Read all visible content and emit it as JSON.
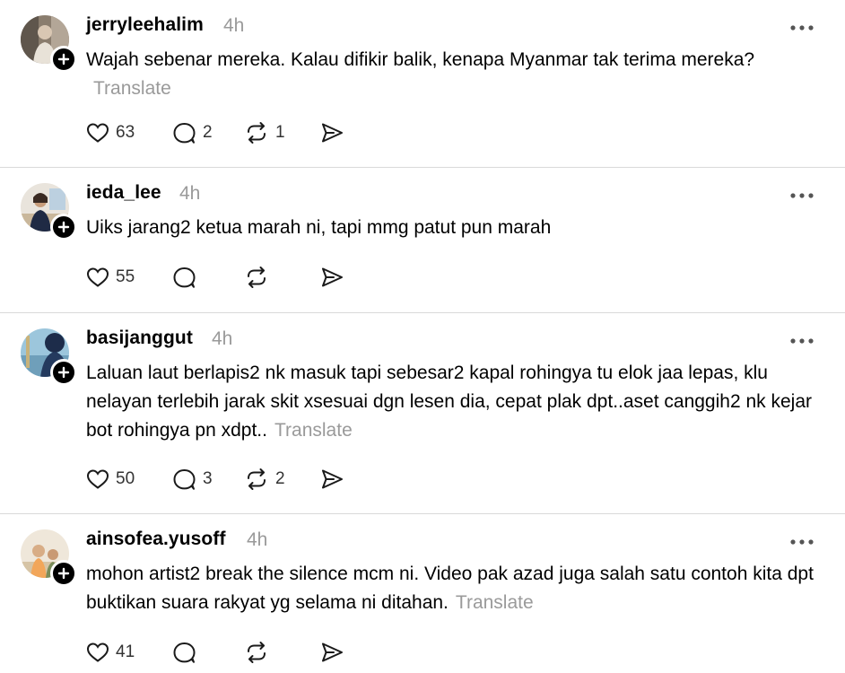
{
  "posts": [
    {
      "username": "jerryleehalim",
      "time": "4h",
      "text": "Wajah sebenar mereka. Kalau difikir balik, kenapa Myanmar tak terima mereka?",
      "translate": "Translate",
      "likes": "63",
      "replies": "2",
      "reposts": "1"
    },
    {
      "username": "ieda_lee",
      "time": "4h",
      "text": "Uiks jarang2 ketua marah ni, tapi mmg patut pun marah",
      "likes": "55"
    },
    {
      "username": "basijanggut",
      "time": "4h",
      "text": "Laluan laut berlapis2 nk masuk tapi sebesar2 kapal rohingya tu elok jaa lepas, klu nelayan terlebih jarak skit xsesuai dgn lesen dia, cepat plak dpt..aset canggih2 nk kejar bot rohingya pn xdpt..",
      "translate": "Translate",
      "likes": "50",
      "replies": "3",
      "reposts": "2"
    },
    {
      "username": "ainsofea.yusoff",
      "time": "4h",
      "text": "mohon artist2 break the silence mcm ni. Video pak azad juga salah satu contoh kita dpt buktikan suara rakyat yg selama ni ditahan.",
      "translate": "Translate",
      "likes": "41"
    }
  ],
  "icons": {
    "like": "heart-icon",
    "reply": "comment-icon",
    "repost": "repost-icon",
    "share": "send-icon",
    "more": "more-horizontal-icon",
    "follow": "plus-icon"
  },
  "colors": {
    "text": "#000000",
    "muted": "#9a9a9a",
    "divider": "#d9d9d9",
    "badge": "#000000"
  }
}
